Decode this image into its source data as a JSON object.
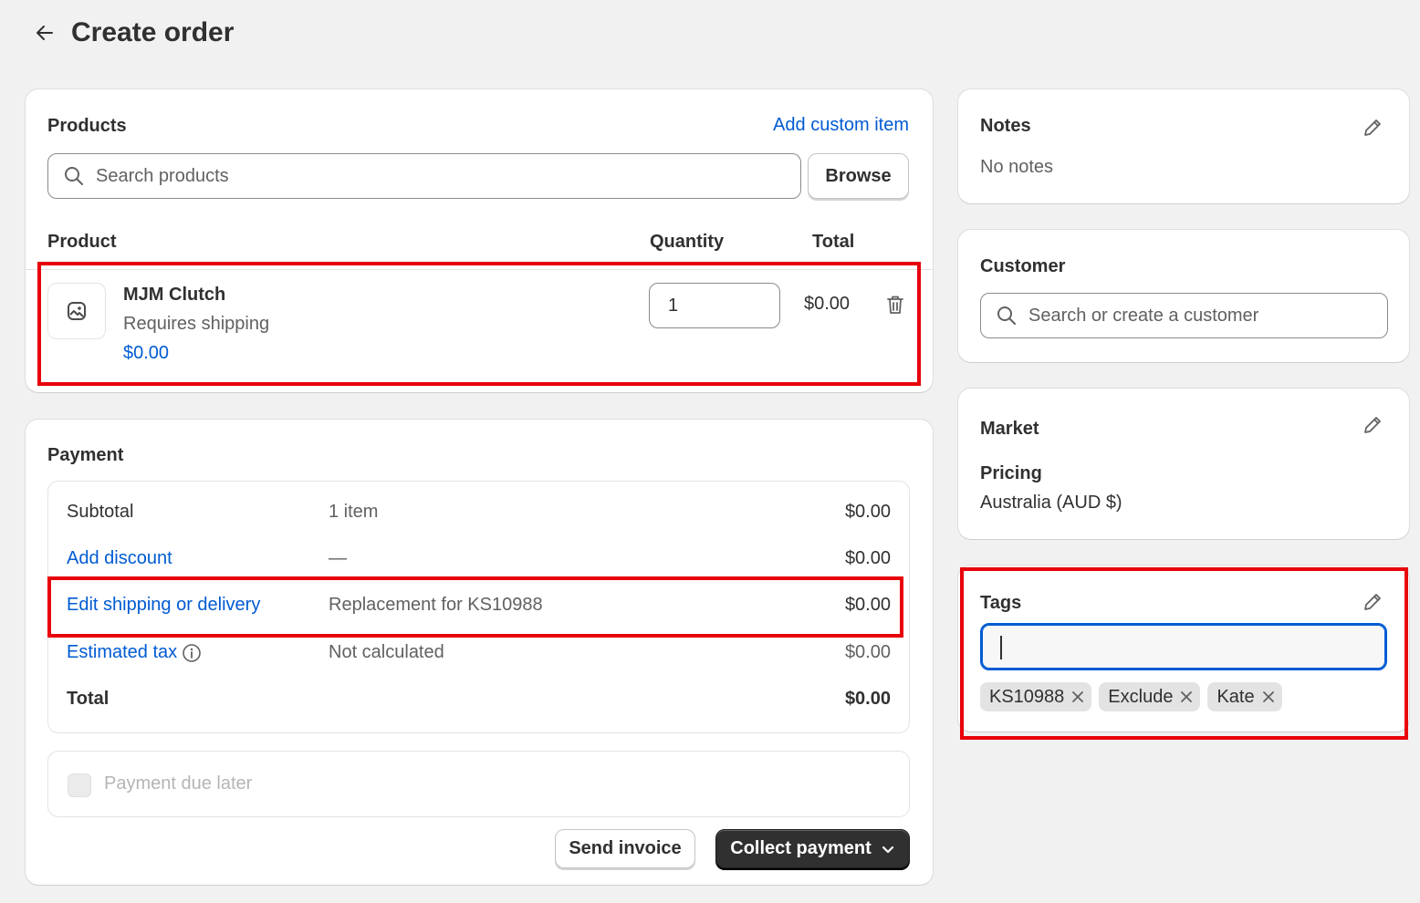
{
  "header": {
    "title": "Create order"
  },
  "products": {
    "title": "Products",
    "add_custom_item": "Add custom item",
    "search_placeholder": "Search products",
    "browse_label": "Browse",
    "columns": {
      "product": "Product",
      "quantity": "Quantity",
      "total": "Total"
    },
    "items": [
      {
        "name": "MJM Clutch",
        "subtitle": "Requires shipping",
        "price": "$0.00",
        "quantity": "1",
        "total": "$0.00"
      }
    ]
  },
  "payment": {
    "title": "Payment",
    "rows": [
      {
        "label": "Subtotal",
        "detail": "1 item",
        "amount": "$0.00"
      },
      {
        "label": "Add discount",
        "detail": "—",
        "amount": "$0.00"
      },
      {
        "label": "Edit shipping or delivery",
        "detail": "Replacement for KS10988",
        "amount": "$0.00"
      },
      {
        "label": "Estimated tax",
        "detail": "Not calculated",
        "amount": "$0.00"
      },
      {
        "label": "Total",
        "detail": "",
        "amount": "$0.00"
      }
    ],
    "payment_due_later": "Payment due later",
    "send_invoice": "Send invoice",
    "collect_payment": "Collect payment"
  },
  "notes": {
    "title": "Notes",
    "text": "No notes"
  },
  "customer": {
    "title": "Customer",
    "search_placeholder": "Search or create a customer"
  },
  "market": {
    "title": "Market",
    "pricing_label": "Pricing",
    "pricing_value": "Australia (AUD $)"
  },
  "tags": {
    "title": "Tags",
    "input_value": "",
    "items": [
      "KS10988",
      "Exclude",
      "Kate"
    ]
  },
  "colors": {
    "link": "#005bd3",
    "highlight": "#e8000b",
    "dark_button": "#303030",
    "background": "#f1f1f1"
  }
}
